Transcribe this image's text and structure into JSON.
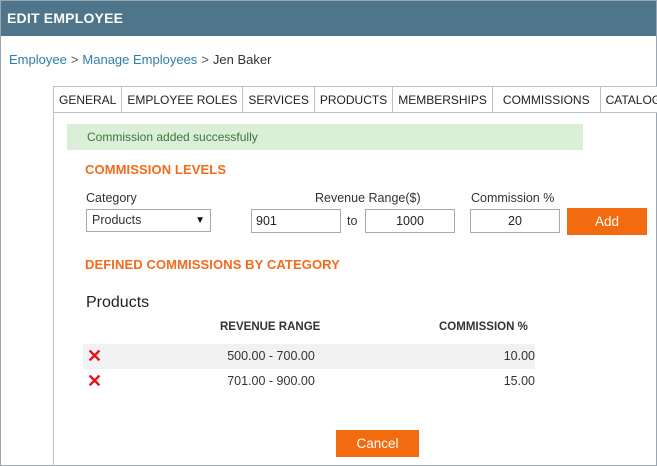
{
  "window": {
    "title": "EDIT EMPLOYEE"
  },
  "breadcrumb": {
    "items": [
      "Employee",
      "Manage Employees",
      "Jen Baker"
    ],
    "separator": ">"
  },
  "tabs": [
    {
      "label": "GENERAL"
    },
    {
      "label": "EMPLOYEE ROLES"
    },
    {
      "label": "SERVICES"
    },
    {
      "label": "PRODUCTS"
    },
    {
      "label": "MEMBERSHIPS"
    },
    {
      "label": "COMMISSIONS",
      "active": true
    },
    {
      "label": "CATALOG"
    }
  ],
  "alert": {
    "message": "Commission added successfully"
  },
  "commission_levels": {
    "title": "COMMISSION LEVELS",
    "category_label": "Category",
    "category_value": "Products",
    "revenue_label": "Revenue Range($)",
    "range_from": "901",
    "range_to_label": "to",
    "range_to": "1000",
    "commission_label": "Commission %",
    "commission_value": "20",
    "add_label": "Add"
  },
  "defined": {
    "title": "DEFINED COMMISSIONS BY CATEGORY",
    "category": "Products",
    "col_range": "REVENUE RANGE",
    "col_commission": "COMMISSION %",
    "rows": [
      {
        "range": "500.00 - 700.00",
        "commission": "10.00"
      },
      {
        "range": "701.00 - 900.00",
        "commission": "15.00"
      }
    ]
  },
  "footer": {
    "cancel_label": "Cancel"
  },
  "colors": {
    "accent": "#f36b0f",
    "header": "#4e7589",
    "delete": "#e8131a",
    "success_bg": "#dbeed8"
  }
}
